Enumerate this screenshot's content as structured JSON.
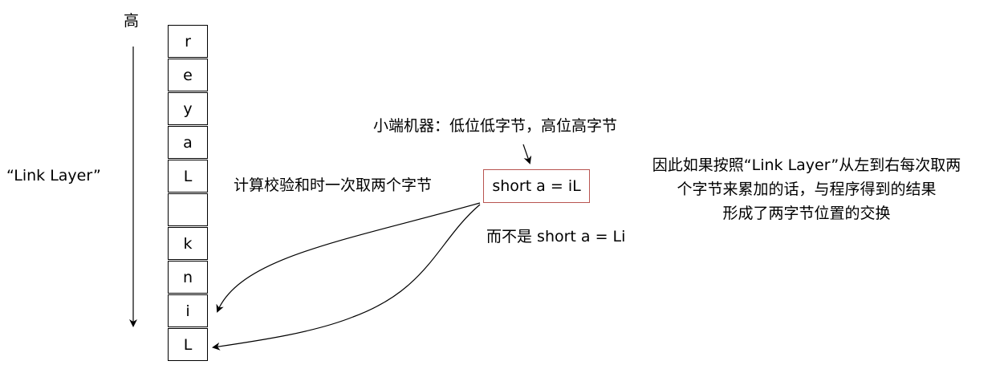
{
  "labels": {
    "high": "高",
    "link_layer": "“Link Layer”",
    "little_endian": "小端机器：低位低字节，高位高字节",
    "checksum_note": "计算校验和时一次取两个字节",
    "short_box": "short a = iL",
    "not_note": "而不是 short a = Li",
    "right_note_lines": [
      "因此如果按照“Link Layer”从左到右每次取两",
      "个字节来累加的话，与程序得到的结果",
      "形成了两字节位置的交换"
    ]
  },
  "stack_cells": [
    "r",
    "e",
    "y",
    "a",
    "L",
    "",
    "k",
    "n",
    "i",
    "L"
  ],
  "colors": {
    "box_border": "#b85450",
    "line": "#000000"
  }
}
